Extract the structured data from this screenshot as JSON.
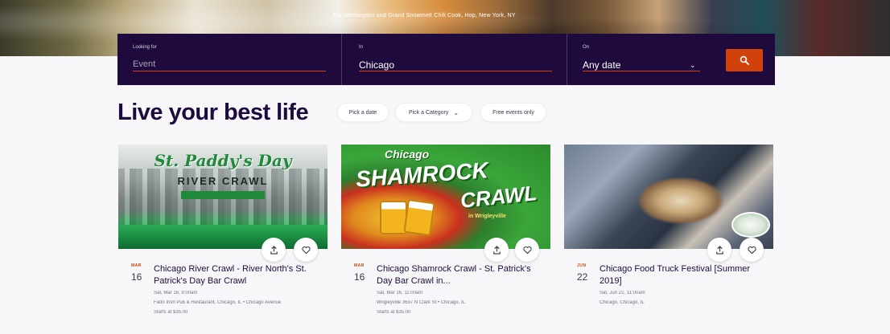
{
  "hero": {
    "caption": "Fat Washington and Grand Snowmelt Chili Cook, Hop, New York, NY"
  },
  "search": {
    "what_label": "Looking for",
    "what_placeholder": "Event",
    "where_label": "In",
    "where_value": "Chicago",
    "when_label": "On",
    "when_value": "Any date",
    "submit_icon": "search-icon"
  },
  "main": {
    "title": "Live your best life",
    "filters": [
      {
        "label": "Pick a date"
      },
      {
        "label": "Pick a Category"
      },
      {
        "label": "Free events only"
      }
    ]
  },
  "events": [
    {
      "image_lines": [
        "St. Paddy's Day",
        "RIVER CRAWL"
      ],
      "month": "MAR",
      "day": "16",
      "title": "Chicago River Crawl - River North's St. Patrick's Day Bar Crawl",
      "datetime": "Sat, Mar 16, 9:00am",
      "venue": "Fado Irish Pub & Restaurant, Chicago, IL • Chicago Avenue",
      "price": "Starts at $35.00"
    },
    {
      "image_lines": [
        "Chicago",
        "SHAMROCK",
        "CRAWL",
        "in Wrigleyville"
      ],
      "month": "MAR",
      "day": "16",
      "title": "Chicago Shamrock Crawl - St. Patrick's Day Bar Crawl in...",
      "datetime": "Sat, Mar 16, 11:00am",
      "venue": "Wrigleyville 3637 N Clark St • Chicago, IL",
      "price": "Starts at $35.00"
    },
    {
      "image_lines": [],
      "month": "JUN",
      "day": "22",
      "title": "Chicago Food Truck Festival [Summer 2019]",
      "datetime": "Sat, Jun 22, 11:00am",
      "venue": "Chicago, Chicago, IL",
      "price": ""
    }
  ],
  "colors": {
    "search_bg": "#1e0a3c",
    "accent": "#d1410c",
    "title": "#1e0a3c"
  }
}
